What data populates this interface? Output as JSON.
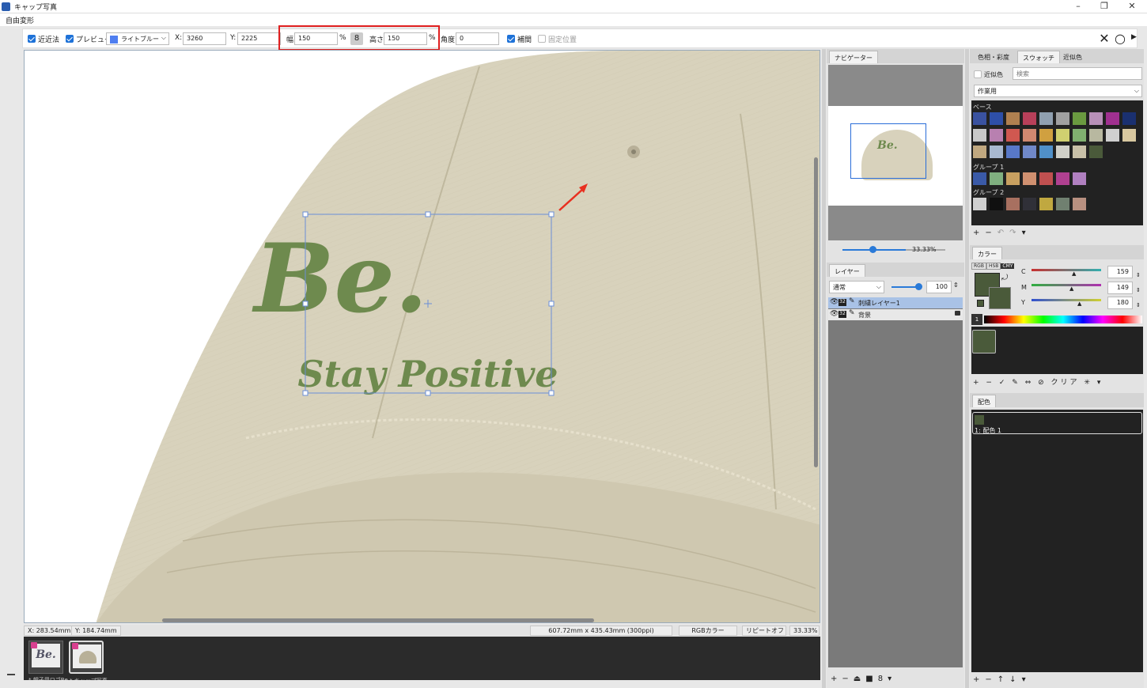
{
  "window": {
    "title": "キャップ写真",
    "min": "–",
    "restore": "❐",
    "close": "✕"
  },
  "menu": {
    "label": "自由変形"
  },
  "toolbar": {
    "nearest_label": "近近法",
    "preview_label": "プレビュー",
    "color_select": "ライトブルー",
    "x_label": "X:",
    "x_value": "3260",
    "y_label": "Y:",
    "y_value": "2225",
    "width_label": "幅",
    "width_value": "150",
    "pct1": "%",
    "link_icon": "8",
    "height_label": "高さ",
    "height_value": "150",
    "pct2": "%",
    "angle_label": "角度",
    "angle_value": "0",
    "interp_label": "補間",
    "fixed_label": "固定位置",
    "cancel": "✕",
    "ok": "○",
    "accent": "#1e72d8"
  },
  "canvas": {
    "logo_main": "Be.",
    "logo_sub": "Stay Positive",
    "cap_color": "#d8d2bc",
    "thread_color": "#6e8a4e"
  },
  "status": {
    "x": "X: 283.54mm",
    "y": "Y: 184.74mm",
    "size": "607.72mm x 435.43mm (300ppi)",
    "colormode": "RGBカラー",
    "repeat": "リピートオフ",
    "zoom": "33.33%"
  },
  "docs": [
    {
      "caption": "* 帽子用ロゴBe...",
      "thumb_text": "Be."
    },
    {
      "caption": "* キャップ写真",
      "thumb_text": ""
    }
  ],
  "navigator": {
    "tab": "ナビゲーター",
    "zoom": "33.33%",
    "thumb_text": "Be."
  },
  "layers": {
    "tab": "レイヤー",
    "blend": "通常",
    "opacity": "100",
    "items": [
      {
        "name": "刺繍レイヤー1",
        "bits": "32",
        "selected": true
      },
      {
        "name": "背景",
        "bits": "32",
        "selected": false
      }
    ]
  },
  "color_panel": {
    "tabs": [
      "色相・彩度",
      "スウォッチ",
      "近似色"
    ],
    "near_label": "近似色",
    "search_placeholder": "検索",
    "palette_select": "作業用",
    "group_base": "ベース",
    "group1": "グループ 1",
    "group2": "グループ 2",
    "base_colors": [
      "#3a52a0",
      "#2e4fa8",
      "#b08050",
      "#b8405a",
      "#90a0b0",
      "#a0a0a0",
      "#6a9a40",
      "#b890b8",
      "#a03090",
      "#1a3070",
      "#c8c8c8",
      "#b880b0",
      "#d05850",
      "#d08870",
      "#d0a040",
      "#d0d070",
      "#80b070",
      "#b8b8a0",
      "#d0d0d0",
      "#d8c8a0",
      "#c0a880",
      "#a8b8d0",
      "#5878c8",
      "#7088c8",
      "#5090c8",
      "#d0d0c8",
      "#c8c0a8",
      "#4a5a3a"
    ],
    "group1_colors": [
      "#3a5aa8",
      "#80b080",
      "#c8a060",
      "#d09070",
      "#c05050",
      "#b04090",
      "#b080c0"
    ],
    "group2_colors": [
      "#d0d0d0",
      "#101010",
      "#a87060",
      "#303038",
      "#c0a840",
      "#708070",
      "#b89080"
    ]
  },
  "color_mixer": {
    "tab": "カラー",
    "modes": [
      "RGB",
      "HSB",
      "CMY"
    ],
    "c_label": "C",
    "c_value": "159",
    "m_label": "M",
    "m_value": "149",
    "y_label": "Y",
    "y_value": "180",
    "fg": "#4a5a3a",
    "clear_label": "クリア",
    "slot_label": "1"
  },
  "scheme": {
    "tab": "配色",
    "item": "1: 配色 1"
  },
  "panel_tools": {
    "plus": "+",
    "minus": "−"
  }
}
